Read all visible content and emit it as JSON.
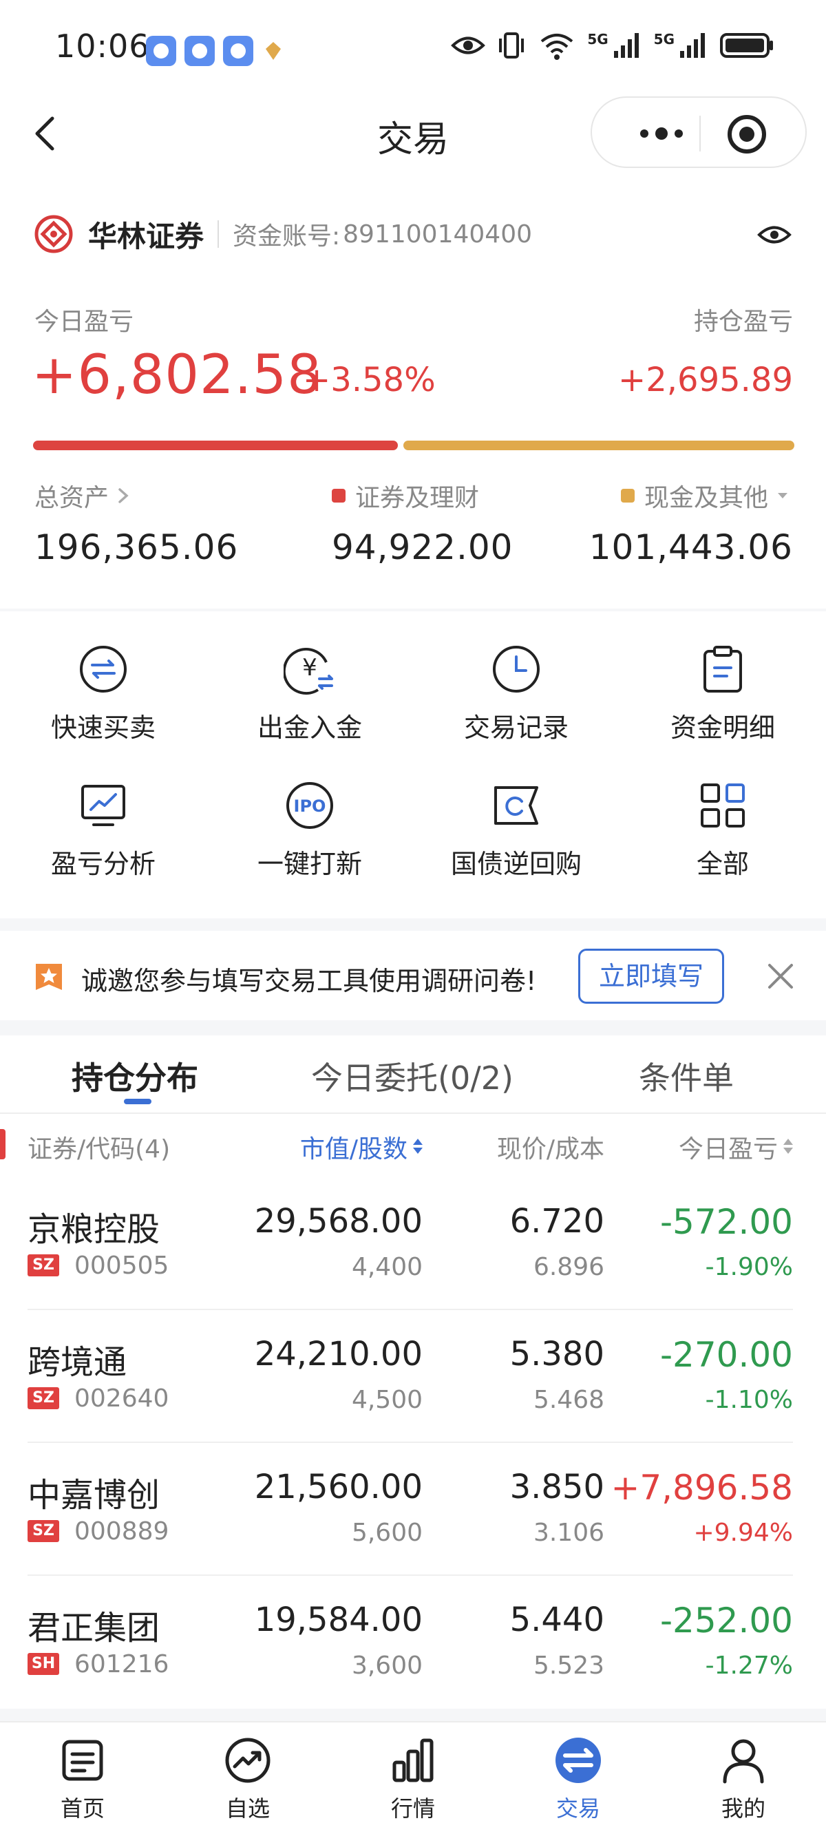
{
  "status_bar": {
    "time": "10:06",
    "sig1": "5G",
    "sig2": "5G"
  },
  "nav": {
    "title": "交易"
  },
  "account": {
    "broker": "华林证券",
    "account_label": "资金账号:",
    "account_no": "891100140400"
  },
  "pnl": {
    "today_label": "今日盈亏",
    "today_value": "+6,802.58",
    "today_pct": "+3.58%",
    "hold_label": "持仓盈亏",
    "hold_value": "+2,695.89",
    "securities_share": 0.483
  },
  "assets": {
    "total_label": "总资产",
    "total_value": "196,365.06",
    "securities_label": "证券及理财",
    "securities_value": "94,922.00",
    "cash_label": "现金及其他",
    "cash_value": "101,443.06"
  },
  "colors": {
    "red": "#e0403f",
    "gold": "#e0a94b",
    "blue": "#3b6fd4",
    "green": "#2f9a4f"
  },
  "grid": [
    {
      "label": "快速买卖",
      "icon": "swap-arrows-icon"
    },
    {
      "label": "出金入金",
      "icon": "yuan-transfer-icon"
    },
    {
      "label": "交易记录",
      "icon": "clock-icon"
    },
    {
      "label": "资金明细",
      "icon": "clipboard-icon"
    },
    {
      "label": "盈亏分析",
      "icon": "monitor-chart-icon"
    },
    {
      "label": "一键打新",
      "icon": "ipo-icon"
    },
    {
      "label": "国债逆回购",
      "icon": "bond-repo-icon"
    },
    {
      "label": "全部",
      "icon": "grid-all-icon"
    }
  ],
  "banner": {
    "text": "诚邀您参与填写交易工具使用调研问卷!",
    "button": "立即填写"
  },
  "tabs": [
    {
      "label": "持仓分布",
      "active": true
    },
    {
      "label": "今日委托(0/2)",
      "active": false
    },
    {
      "label": "条件单",
      "active": false
    }
  ],
  "table": {
    "headers": [
      "证券/代码(4)",
      "市值/股数",
      "现价/成本",
      "今日盈亏"
    ],
    "rows": [
      {
        "name": "京粮控股",
        "market": "SZ",
        "code": "000505",
        "market_value": "29,568.00",
        "shares": "4,400",
        "price": "6.720",
        "cost": "6.896",
        "pnl": "-572.00",
        "pnl_pct": "-1.90%",
        "direction": "neg"
      },
      {
        "name": "跨境通",
        "market": "SZ",
        "code": "002640",
        "market_value": "24,210.00",
        "shares": "4,500",
        "price": "5.380",
        "cost": "5.468",
        "pnl": "-270.00",
        "pnl_pct": "-1.10%",
        "direction": "neg"
      },
      {
        "name": "中嘉博创",
        "market": "SZ",
        "code": "000889",
        "market_value": "21,560.00",
        "shares": "5,600",
        "price": "3.850",
        "cost": "3.106",
        "pnl": "+7,896.58",
        "pnl_pct": "+9.94%",
        "direction": "pos"
      },
      {
        "name": "君正集团",
        "market": "SH",
        "code": "601216",
        "market_value": "19,584.00",
        "shares": "3,600",
        "price": "5.440",
        "cost": "5.523",
        "pnl": "-252.00",
        "pnl_pct": "-1.27%",
        "direction": "neg"
      }
    ]
  },
  "bottom_nav": [
    {
      "label": "首页",
      "icon": "home-doc-icon",
      "active": false
    },
    {
      "label": "自选",
      "icon": "trend-circle-icon",
      "active": false
    },
    {
      "label": "行情",
      "icon": "bar-chart-icon",
      "active": false
    },
    {
      "label": "交易",
      "icon": "exchange-icon",
      "active": true
    },
    {
      "label": "我的",
      "icon": "person-icon",
      "active": false
    }
  ]
}
